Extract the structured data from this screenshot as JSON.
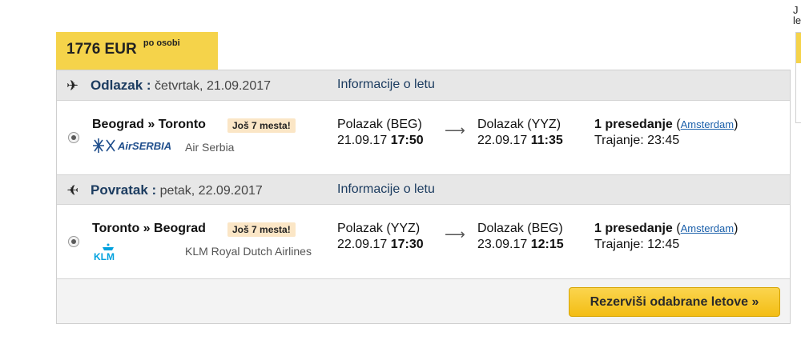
{
  "price": {
    "amount": "1776 EUR",
    "per_person": "po osobi"
  },
  "outbound": {
    "header_label": "Odlazak :",
    "header_date": " četvrtak, 21.09.2017",
    "info_link": "Informacije o letu",
    "route": "Beograd » Toronto",
    "seats": "Još 7 mesta!",
    "airline_logo_text": "AirSERBIA",
    "airline_name": "Air Serbia",
    "departure_label": "Polazak (BEG)",
    "departure_date": "21.09.17 ",
    "departure_time": "17:50",
    "arrow": "⟶",
    "arrival_label": "Dolazak (YYZ)",
    "arrival_date": "22.09.17 ",
    "arrival_time": "11:35",
    "stops_label": "1 presedanje",
    "stops_open": " (",
    "stop_city": "Amsterdam",
    "stops_close": ")",
    "duration": "Trajanje: 23:45"
  },
  "return": {
    "header_label": "Povratak :",
    "header_date": " petak, 22.09.2017",
    "info_link": "Informacije o letu",
    "route": "Toronto » Beograd",
    "seats": "Još 7 mesta!",
    "airline_logo_text": "KLM",
    "airline_name": "KLM Royal Dutch Airlines",
    "departure_label": "Polazak (YYZ)",
    "departure_date": "22.09.17 ",
    "departure_time": "17:30",
    "arrow": "⟶",
    "arrival_label": "Dolazak (BEG)",
    "arrival_date": "23.09.17 ",
    "arrival_time": "12:15",
    "stops_label": "1 presedanje",
    "stops_open": " (",
    "stop_city": "Amsterdam",
    "stops_close": ")",
    "duration": "Trajanje: 12:45"
  },
  "book_button": "Rezerviši odabrane letove »",
  "corner_text": [
    "J",
    "le"
  ],
  "colors": {
    "accent_yellow": "#f5d34a",
    "header_gray": "#e7e7e7",
    "title_blue": "#1c3c60",
    "link_blue": "#1a5faa",
    "seats_badge": "#fbe6c6"
  },
  "icons": {
    "outbound": "plane-departure-icon",
    "return": "plane-arrival-icon"
  }
}
